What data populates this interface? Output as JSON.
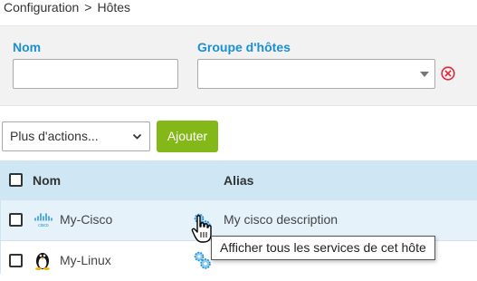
{
  "breadcrumb": {
    "items": [
      "Configuration",
      "Hôtes"
    ],
    "separator": ">"
  },
  "filters": {
    "name_label": "Nom",
    "name_value": "",
    "hostgroup_label": "Groupe d'hôtes",
    "hostgroup_value": "",
    "clear_icon": "clear-circle-icon"
  },
  "toolbar": {
    "more_actions": "Plus d'actions...",
    "add_label": "Ajouter"
  },
  "table": {
    "columns": [
      "Nom",
      "Alias"
    ],
    "rows": [
      {
        "name": "My-Cisco",
        "alias": "My cisco description",
        "icon": "cisco-logo",
        "action_icon": "gear-services-icon"
      },
      {
        "name": "My-Linux",
        "alias": "",
        "icon": "linux-penguin",
        "action_icon": "gear-services-icon"
      }
    ]
  },
  "tooltip": {
    "text": "Afficher tous les services de cet hôte"
  },
  "colors": {
    "accent_blue": "#1a8fd6",
    "add_green": "#84b818",
    "header_blue": "#cfe7f4",
    "clear_red": "#e2273a"
  }
}
